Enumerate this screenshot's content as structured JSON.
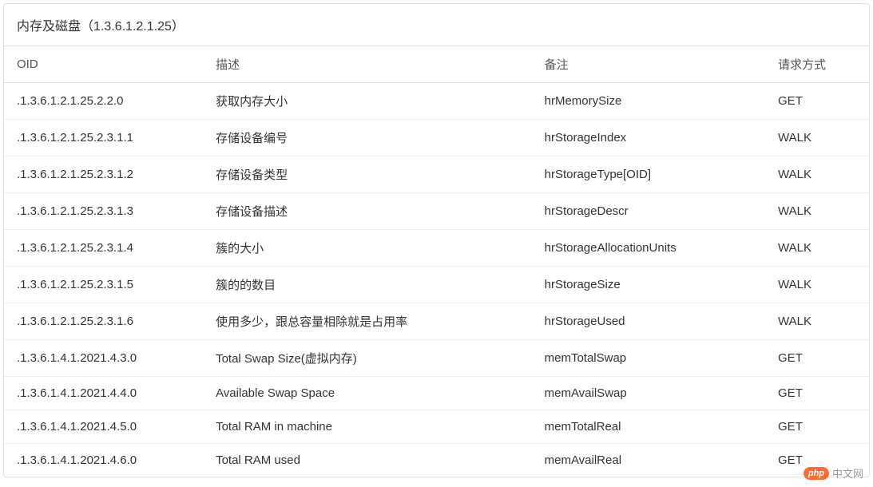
{
  "table": {
    "title": "内存及磁盘（1.3.6.1.2.1.25）",
    "headers": {
      "oid": "OID",
      "description": "描述",
      "note": "备注",
      "method": "请求方式"
    },
    "rows": [
      {
        "oid": ".1.3.6.1.2.1.25.2.2.0",
        "description": "获取内存大小",
        "note": "hrMemorySize",
        "method": "GET"
      },
      {
        "oid": ".1.3.6.1.2.1.25.2.3.1.1",
        "description": "存储设备编号",
        "note": "hrStorageIndex",
        "method": "WALK"
      },
      {
        "oid": ".1.3.6.1.2.1.25.2.3.1.2",
        "description": "存储设备类型",
        "note": "hrStorageType[OID]",
        "method": "WALK"
      },
      {
        "oid": ".1.3.6.1.2.1.25.2.3.1.3",
        "description": "存储设备描述",
        "note": "hrStorageDescr",
        "method": "WALK"
      },
      {
        "oid": ".1.3.6.1.2.1.25.2.3.1.4",
        "description": "簇的大小",
        "note": "hrStorageAllocationUnits",
        "method": "WALK"
      },
      {
        "oid": ".1.3.6.1.2.1.25.2.3.1.5",
        "description": "簇的的数目",
        "note": "hrStorageSize",
        "method": "WALK"
      },
      {
        "oid": ".1.3.6.1.2.1.25.2.3.1.6",
        "description": "使用多少，跟总容量相除就是占用率",
        "note": "hrStorageUsed",
        "method": "WALK"
      },
      {
        "oid": ".1.3.6.1.4.1.2021.4.3.0",
        "description": "Total Swap Size(虚拟内存)",
        "note": "memTotalSwap",
        "method": "GET"
      },
      {
        "oid": ".1.3.6.1.4.1.2021.4.4.0",
        "description": "Available Swap Space",
        "note": "memAvailSwap",
        "method": "GET"
      },
      {
        "oid": ".1.3.6.1.4.1.2021.4.5.0",
        "description": "Total RAM in machine",
        "note": "memTotalReal",
        "method": "GET"
      },
      {
        "oid": ".1.3.6.1.4.1.2021.4.6.0",
        "description": "Total RAM used",
        "note": "memAvailReal",
        "method": "GET"
      }
    ]
  },
  "watermark": {
    "badge": "php",
    "text": "中文网"
  }
}
